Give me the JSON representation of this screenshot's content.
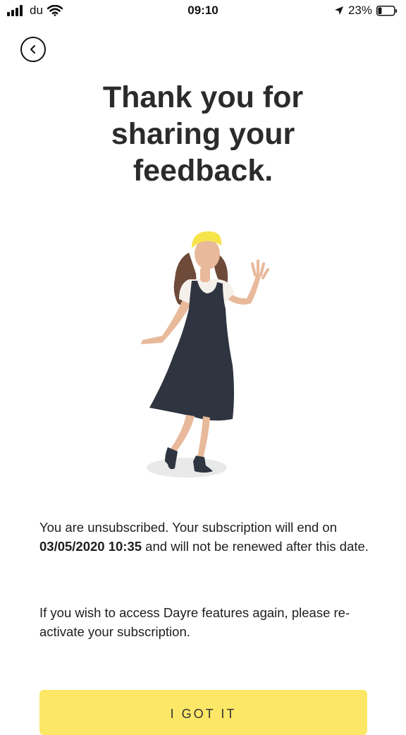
{
  "status_bar": {
    "carrier": "du",
    "time": "09:10",
    "battery_percent": "23%",
    "battery_level": 0.23,
    "icons": [
      "signal-icon",
      "wifi-icon",
      "location-arrow-icon",
      "battery-icon"
    ]
  },
  "header": {
    "back_icon": "chevron-left-icon"
  },
  "main": {
    "title_line1": "Thank you for",
    "title_line2": "sharing your",
    "title_line3": "feedback.",
    "para1_text_a": "You are unsubscribed. Your subscription will end on ",
    "para1_date": "03/05/2020 10:35",
    "para1_text_b": " and will not be renewed after this date.",
    "para2_text": "If you wish to access Dayre features again, please re-activate your subscription."
  },
  "actions": {
    "got_it_label": "I GOT IT"
  },
  "colors": {
    "accent_yellow": "#fde767",
    "dress": "#2f3540",
    "skin": "#e8b99b",
    "hair": "#6e4a3a"
  }
}
